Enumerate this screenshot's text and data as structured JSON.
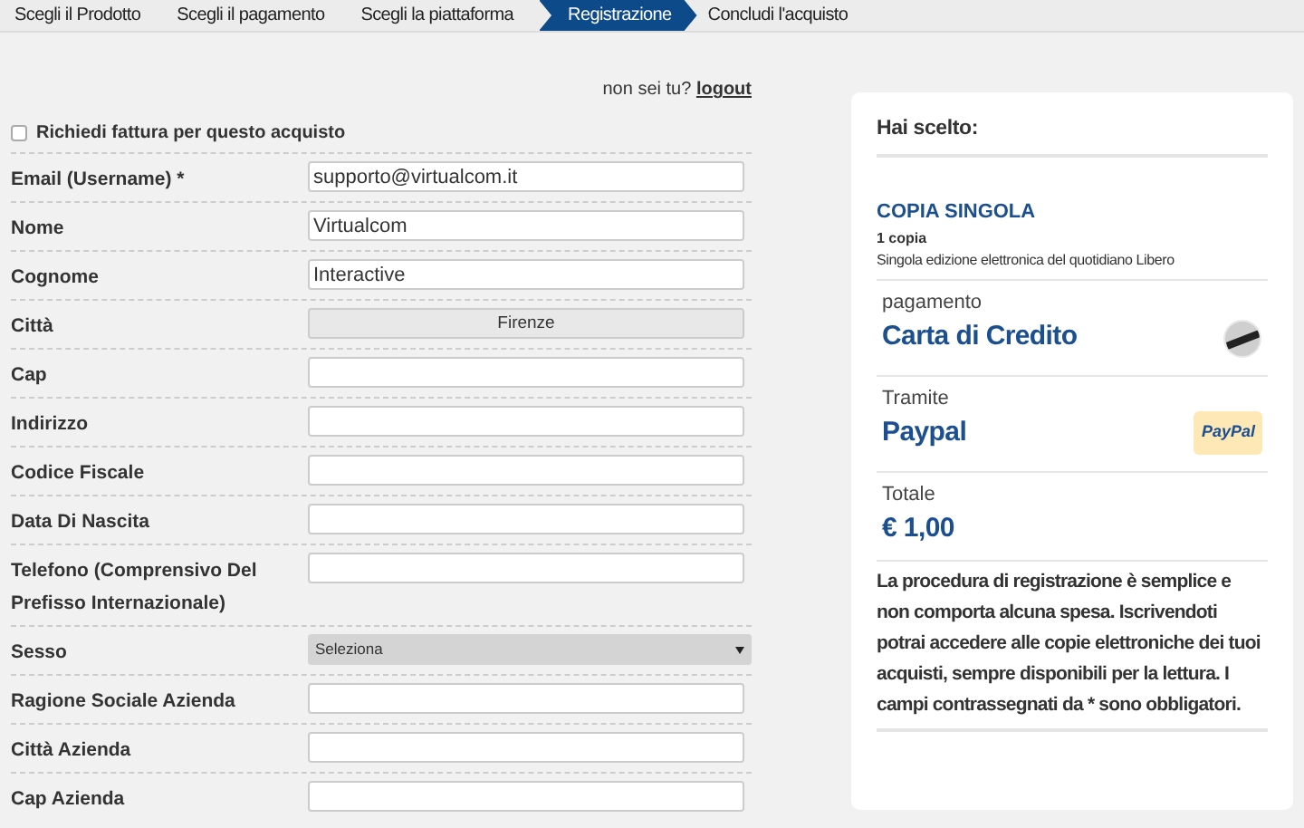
{
  "steps": [
    {
      "label": "Scegli il Prodotto",
      "selected": false
    },
    {
      "label": "Scegli il pagamento",
      "selected": false
    },
    {
      "label": "Scegli la piattaforma",
      "selected": false
    },
    {
      "label": "Registrazione",
      "selected": true
    },
    {
      "label": "Concludi l'acquisto",
      "selected": false
    }
  ],
  "user_line": {
    "text": "non sei tu?",
    "link": "logout"
  },
  "invoice": {
    "label": "Richiedi fattura per questo acquisto",
    "checked": false
  },
  "fields": [
    {
      "label": "Email (Username) *",
      "kind": "text",
      "value": "supporto@virtualcom.it"
    },
    {
      "label": "Nome",
      "kind": "text",
      "value": "Virtualcom"
    },
    {
      "label": "Cognome",
      "kind": "text",
      "value": "Interactive"
    },
    {
      "label": "Città",
      "kind": "static",
      "value": "Firenze"
    },
    {
      "label": "Cap",
      "kind": "text"
    },
    {
      "label": "Indirizzo",
      "kind": "text"
    },
    {
      "label": "Codice Fiscale",
      "kind": "text"
    },
    {
      "label": "Data Di Nascita",
      "kind": "text"
    },
    {
      "label": "Telefono (Comprensivo Del Prefisso Internazionale)",
      "kind": "text"
    },
    {
      "label": "Sesso",
      "kind": "select",
      "value": "Seleziona"
    },
    {
      "label": "Ragione Sociale Azienda",
      "kind": "text"
    },
    {
      "label": "Città Azienda",
      "kind": "text"
    },
    {
      "label": "Cap Azienda",
      "kind": "text"
    }
  ],
  "summary": {
    "title": "Hai scelto:",
    "product": {
      "name": "COPIA SINGOLA",
      "quantity": "1 copia",
      "description": "Singola edizione elettronica del quotidiano Libero"
    },
    "sections": [
      {
        "caption": "pagamento",
        "value": "Carta di Credito",
        "kind": "card"
      },
      {
        "caption": "Tramite",
        "value": "Paypal",
        "kind": "paypal",
        "logo_text": "PayPal"
      },
      {
        "caption": "Totale",
        "value": "€ 1,00"
      }
    ],
    "note": "La procedura di registrazione è semplice e non comporta alcuna spesa. Iscrivendoti potrai accedere alle copie elettroniche dei tuoi acquisti, sempre disponibili per la lettura. I campi contrassegnati da * sono obbligatori."
  }
}
